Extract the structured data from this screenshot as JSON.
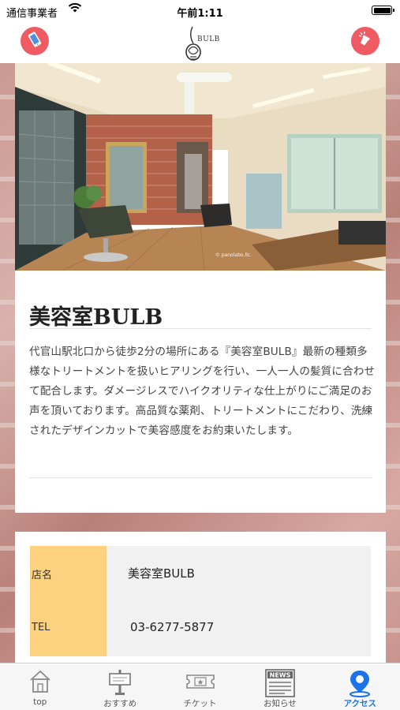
{
  "status_bar": {
    "carrier": "通信事業者",
    "time": "午前1:11"
  },
  "header": {
    "logo_text": "BULB",
    "left_button_icon": "phone-icon",
    "right_button_icon": "flashlight-icon",
    "accent_color": "#ee5b63"
  },
  "photo": {
    "credit": "© panolabo,llc."
  },
  "salon": {
    "title": "美容室BULB",
    "description": "代官山駅北口から徒歩2分の場所にある『美容室BULB』最新の種類多様なトリートメントを扱いヒアリングを行い、一人一人の髪質に合わせて配合します。ダメージレスでハイクオリティな仕上がりにご満足のお声を頂いております。高品質な薬剤、トリートメントにこだわり、洗練されたデザインカットで美容感度をお約束いたします。"
  },
  "info": {
    "rows": [
      {
        "label": "店名",
        "value": "美容室BULB"
      },
      {
        "label": "TEL",
        "value": "03-6277-5877"
      }
    ],
    "label_color": "#fcd17f"
  },
  "tab_bar": {
    "tabs": [
      {
        "label": "top",
        "icon": "house-icon"
      },
      {
        "label": "おすすめ",
        "icon": "signboard-icon"
      },
      {
        "label": "チケット",
        "icon": "ticket-icon"
      },
      {
        "label": "お知らせ",
        "icon": "news-icon"
      },
      {
        "label": "アクセス",
        "icon": "location-pin-icon"
      }
    ],
    "active_index": 4,
    "active_color": "#1a73e8"
  }
}
